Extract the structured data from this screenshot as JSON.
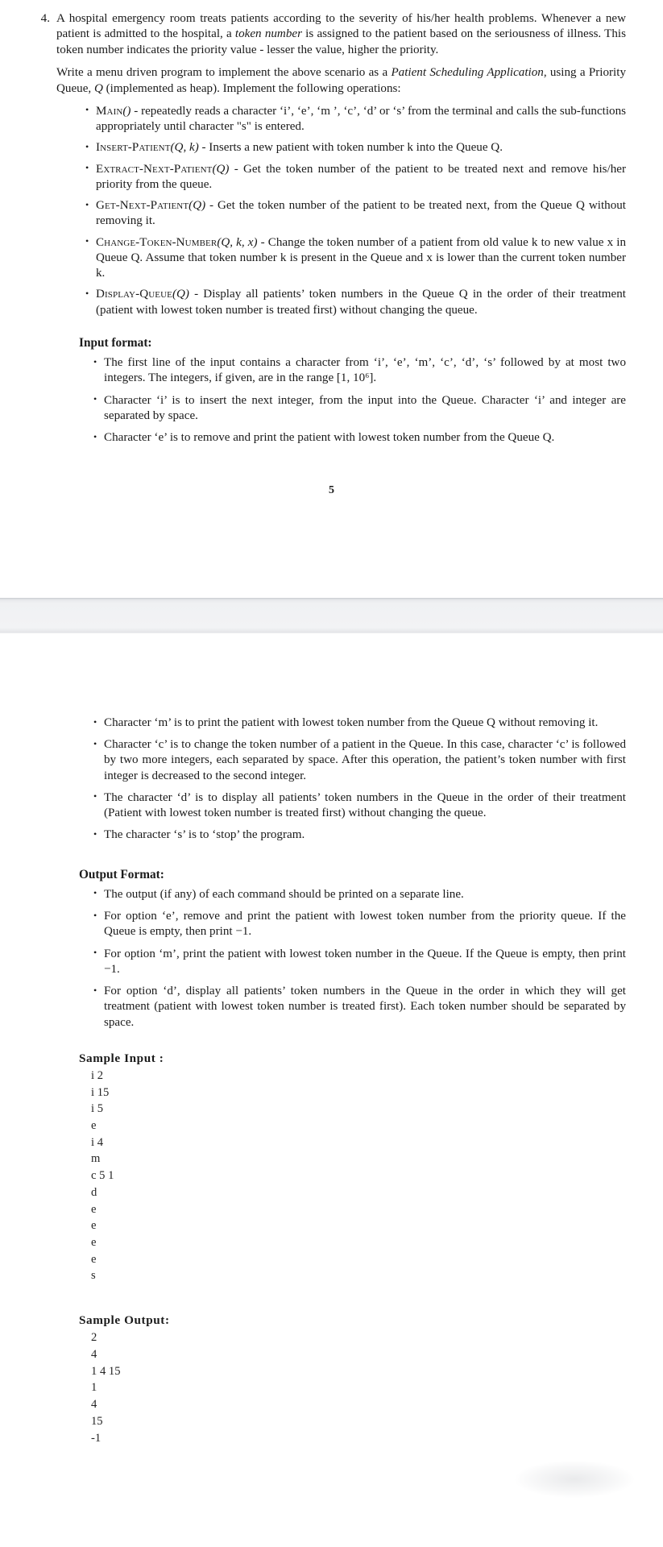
{
  "document": {
    "page_number": "5",
    "problem": {
      "number": "4.",
      "paragraph_1": "A hospital emergency room treats patients according to the severity of his/her health problems. Whenever a new patient is admitted to the hospital, a token number is assigned to the patient based on the seriousness of illness. This token number indicates the priority value - lesser the value, higher the priority.",
      "paragraph_1_italic": "token number",
      "paragraph_2_a": "Write a menu driven program to implement the above scenario as a ",
      "paragraph_2_italic": "Patient Scheduling Application",
      "paragraph_2_b": ", using a Priority Queue, ",
      "paragraph_2_q": "Q",
      "paragraph_2_c": " (implemented as heap). Implement the following operations:"
    },
    "operations": [
      {
        "name": "Main",
        "signature": "()",
        "text": " - repeatedly reads a character ‘i’, ‘e’, ‘m ’, ‘c’, ‘d’ or ‘s’ from the terminal and calls the sub-functions appropriately until character \"s\" is entered."
      },
      {
        "name": "Insert-Patient",
        "signature": "(Q, k)",
        "text": " - Inserts a new patient with token number k into the Queue Q."
      },
      {
        "name": "Extract-Next-Patient",
        "signature": "(Q)",
        "text": " - Get the token number of the patient to be treated next and remove his/her priority from the queue."
      },
      {
        "name": "Get-Next-Patient",
        "signature": "(Q)",
        "text": " - Get the token number of the patient to be treated next, from the Queue Q without removing it."
      },
      {
        "name": "Change-Token-Number",
        "signature": "(Q, k, x)",
        "text": " - Change the token number of a patient from old value k to new value x in Queue Q. Assume that token number k is present in the Queue and x is lower than the current token number k."
      },
      {
        "name": "Display-Queue",
        "signature": "(Q)",
        "text": " - Display all patients’ token numbers in the Queue Q in the order of their treatment (patient with lowest token number is treated first) without changing the queue."
      }
    ],
    "input_format": {
      "heading": "Input format:",
      "items": [
        "The first line of the input contains a character from ‘i’, ‘e’, ‘m’, ‘c’, ‘d’, ‘s’ followed by at most two integers. The integers, if given, are in the range [1, 10⁶].",
        "Character ‘i’ is to insert the next integer, from the input into the Queue. Character ‘i’ and integer are separated by space.",
        "Character ‘e’ is to remove and print the patient with lowest token number from the Queue Q.",
        "Character ‘m’ is to print the patient with lowest token number from the Queue Q without removing it.",
        "Character ‘c’ is to change the token number of a patient in the Queue. In this case, character ‘c’ is followed by two more integers, each separated by space. After this operation, the patient’s token number with first integer is decreased to the second integer.",
        "The character ‘d’ is to display all patients’ token numbers in the Queue in the order of their treatment (Patient with lowest token number is treated first) without changing the queue.",
        "The character ‘s’ is to ‘stop’ the program."
      ]
    },
    "output_format": {
      "heading": "Output Format:",
      "items": [
        "The output (if any) of each command should be printed on a separate line.",
        "For option ‘e’, remove and print the patient with lowest token number from the priority queue. If the Queue is empty, then print −1.",
        "For option ‘m’, print the patient with lowest token number in the Queue. If the Queue is empty, then print −1.",
        "For option ‘d’, display all patients’ token numbers in the Queue in the order in which they will get treatment (patient with lowest token number is treated first). Each token number should be separated by space."
      ]
    },
    "sample_input": {
      "title": "Sample Input :",
      "lines": [
        "i 2",
        "i 15",
        "i 5",
        "e",
        "i 4",
        "m",
        "c 5 1",
        "d",
        "e",
        "e",
        "e",
        "e",
        "s"
      ]
    },
    "sample_output": {
      "title": "Sample Output:",
      "lines": [
        "2",
        "4",
        "1 4 15",
        "1",
        "4",
        "15",
        "-1"
      ]
    }
  }
}
